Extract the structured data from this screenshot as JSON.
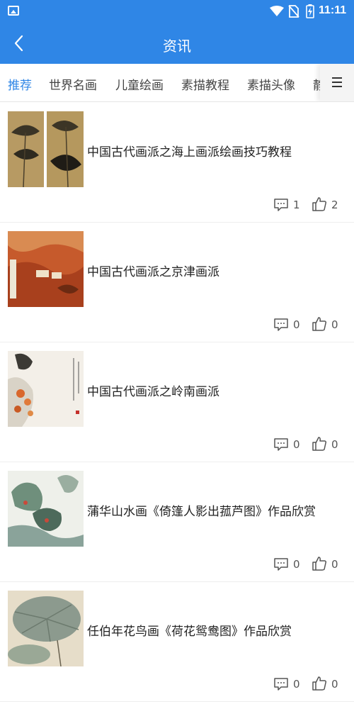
{
  "status_bar": {
    "time": "11:11",
    "icons": [
      "image-icon",
      "wifi-icon",
      "no-sim-icon",
      "battery-charging-icon"
    ]
  },
  "app_bar": {
    "title": "资讯",
    "back_icon": "chevron-left-icon"
  },
  "tabs": [
    {
      "label": "推荐",
      "active": true
    },
    {
      "label": "世界名画",
      "active": false
    },
    {
      "label": "儿童绘画",
      "active": false
    },
    {
      "label": "素描教程",
      "active": false
    },
    {
      "label": "素描头像",
      "active": false
    },
    {
      "label": "静",
      "active": false
    }
  ],
  "tab_menu_icon": "menu-icon",
  "colors": {
    "primary": "#2f86e6",
    "text": "#222222",
    "muted": "#555555"
  },
  "articles": [
    {
      "title": "中国古代画派之海上画派绘画技巧教程",
      "comments": "1",
      "likes": "2"
    },
    {
      "title": "中国古代画派之京津画派",
      "comments": "0",
      "likes": "0"
    },
    {
      "title": "中国古代画派之岭南画派",
      "comments": "0",
      "likes": "0"
    },
    {
      "title": "蒲华山水画《倚篷人影出菰芦图》作品欣赏",
      "comments": "0",
      "likes": "0"
    },
    {
      "title": "任伯年花鸟画《荷花鸳鸯图》作品欣赏",
      "comments": "0",
      "likes": "0"
    }
  ]
}
